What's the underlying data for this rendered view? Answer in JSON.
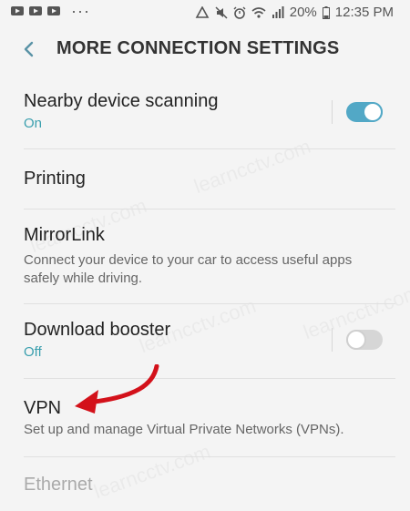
{
  "status_bar": {
    "left_icons": [
      "youtube-icon",
      "youtube-icon",
      "youtube-icon"
    ],
    "overflow": "···",
    "right_icons": [
      "sync-icon",
      "mute-icon",
      "alarm-icon",
      "wifi-icon",
      "signal-icon"
    ],
    "battery": "20%",
    "time": "12:35 PM"
  },
  "header": {
    "back_icon": "back-arrow-icon",
    "title": "MORE CONNECTION SETTINGS"
  },
  "items": [
    {
      "title": "Nearby device scanning",
      "status": "On",
      "toggle": "on"
    },
    {
      "title": "Printing"
    },
    {
      "title": "MirrorLink",
      "subtitle": "Connect your device to your car to access useful apps safely while driving."
    },
    {
      "title": "Download booster",
      "status": "Off",
      "toggle": "off"
    },
    {
      "title": "VPN",
      "subtitle": "Set up and manage Virtual Private Networks (VPNs)."
    },
    {
      "title": "Ethernet"
    }
  ],
  "watermark": "learncctv.com",
  "colors": {
    "accent": "#52a8c6",
    "status_text": "#3a9fae",
    "arrow": "#d3111a"
  }
}
